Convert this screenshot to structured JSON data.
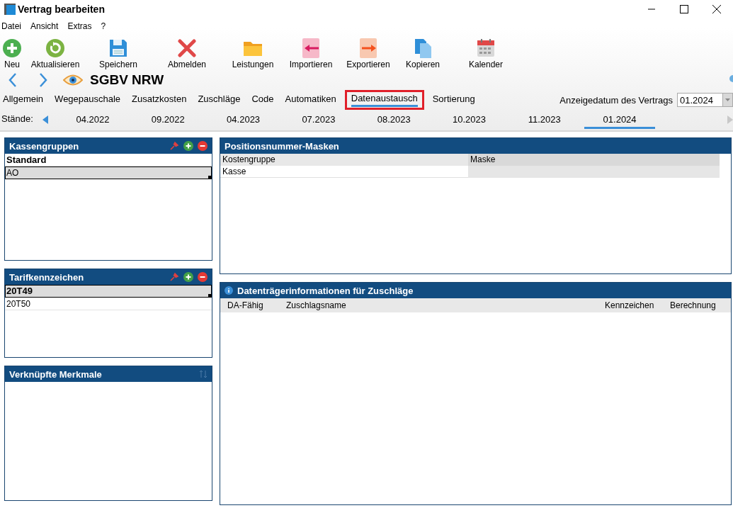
{
  "window": {
    "title": "Vertrag bearbeiten"
  },
  "menu": [
    "Datei",
    "Ansicht",
    "Extras",
    "?"
  ],
  "toolbar": [
    {
      "label": "Neu",
      "kind": "new"
    },
    {
      "label": "Aktualisieren",
      "kind": "refresh"
    },
    {
      "label": "Speichern",
      "kind": "save"
    },
    {
      "label": "Abmelden",
      "kind": "cancel"
    },
    {
      "label": "Leistungen",
      "kind": "folder"
    },
    {
      "label": "Importieren",
      "kind": "import"
    },
    {
      "label": "Exportieren",
      "kind": "export"
    },
    {
      "label": "Kopieren",
      "kind": "copy"
    },
    {
      "label": "Kalender",
      "kind": "calendar"
    }
  ],
  "record": {
    "title": "SGBV NRW"
  },
  "tabs": [
    {
      "label": "Allgemein",
      "selected": false
    },
    {
      "label": "Wegepauschale",
      "selected": false
    },
    {
      "label": "Zusatzkosten",
      "selected": false
    },
    {
      "label": "Zuschläge",
      "selected": false
    },
    {
      "label": "Code",
      "selected": false
    },
    {
      "label": "Automatiken",
      "selected": false
    },
    {
      "label": "Datenaustausch",
      "selected": true
    },
    {
      "label": "Sortierung",
      "selected": false
    }
  ],
  "display_date": {
    "label": "Anzeigedatum des Vertrags",
    "value": "01.2024"
  },
  "versions": {
    "label": "Stände:",
    "items": [
      {
        "label": "04.2022",
        "selected": false
      },
      {
        "label": "09.2022",
        "selected": false
      },
      {
        "label": "04.2023",
        "selected": false
      },
      {
        "label": "07.2023",
        "selected": false
      },
      {
        "label": "08.2023",
        "selected": false
      },
      {
        "label": "10.2023",
        "selected": false
      },
      {
        "label": "11.2023",
        "selected": false
      },
      {
        "label": "01.2024",
        "selected": true
      }
    ]
  },
  "kassengruppen": {
    "title": "Kassengruppen",
    "items": [
      {
        "label": "Standard",
        "bold": true,
        "selected": false
      },
      {
        "label": "AO",
        "bold": false,
        "selected": true
      }
    ]
  },
  "tarifkennzeichen": {
    "title": "Tarifkennzeichen",
    "items": [
      {
        "label": "20T49",
        "bold": true,
        "selected": true
      },
      {
        "label": "20T50",
        "bold": false,
        "selected": false
      }
    ]
  },
  "merkmale": {
    "title": "Verknüpfte Merkmale"
  },
  "masks": {
    "title": "Positionsnummer-Masken",
    "columns": [
      "Kostengruppe",
      "Maske"
    ],
    "rows": [
      {
        "kostengruppe": "Kasse"
      }
    ]
  },
  "zuschlaege": {
    "title": "Datenträgerinformationen für Zuschläge",
    "columns": [
      "DA-Fähig",
      "Zuschlagsname",
      "Kennzeichen",
      "Berechnung"
    ]
  }
}
